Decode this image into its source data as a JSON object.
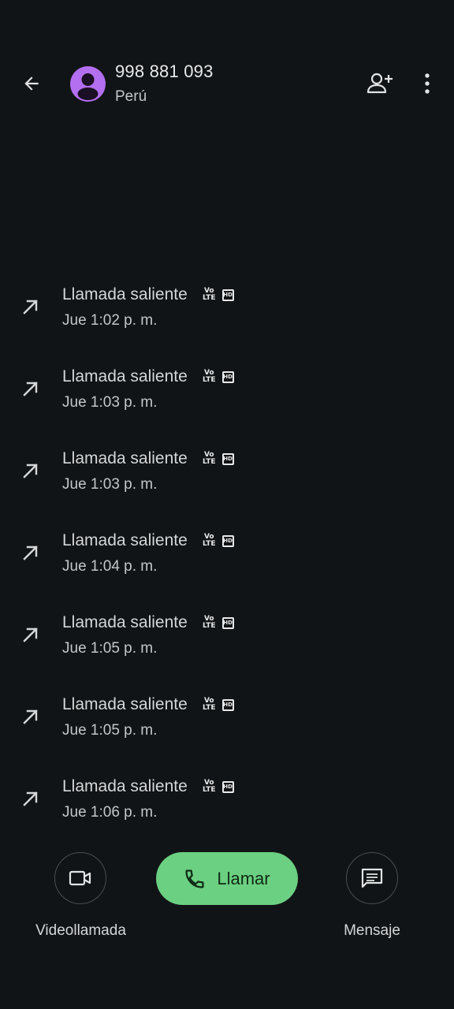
{
  "header": {
    "back_icon": "arrow-back-icon",
    "number": "998 881 093",
    "country": "Perú",
    "avatar_color": "#b46ff0",
    "add_contact_icon": "person-add-icon",
    "more_icon": "more-vert-icon"
  },
  "calls": [
    {
      "type": "Llamada saliente",
      "time": "Jue 1:02 p. m.",
      "volte_top": "Vo",
      "volte_bottom": "LTE",
      "hd": "HD"
    },
    {
      "type": "Llamada saliente",
      "time": "Jue 1:03 p. m.",
      "volte_top": "Vo",
      "volte_bottom": "LTE",
      "hd": "HD"
    },
    {
      "type": "Llamada saliente",
      "time": "Jue 1:03 p. m.",
      "volte_top": "Vo",
      "volte_bottom": "LTE",
      "hd": "HD"
    },
    {
      "type": "Llamada saliente",
      "time": "Jue 1:04 p. m.",
      "volte_top": "Vo",
      "volte_bottom": "LTE",
      "hd": "HD"
    },
    {
      "type": "Llamada saliente",
      "time": "Jue 1:05 p. m.",
      "volte_top": "Vo",
      "volte_bottom": "LTE",
      "hd": "HD"
    },
    {
      "type": "Llamada saliente",
      "time": "Jue 1:05 p. m.",
      "volte_top": "Vo",
      "volte_bottom": "LTE",
      "hd": "HD"
    },
    {
      "type": "Llamada saliente",
      "time": "Jue 1:06 p. m.",
      "volte_top": "Vo",
      "volte_bottom": "LTE",
      "hd": "HD"
    }
  ],
  "actions": {
    "video_label": "Videollamada",
    "call_label": "Llamar",
    "message_label": "Mensaje",
    "call_color": "#6bd081"
  }
}
